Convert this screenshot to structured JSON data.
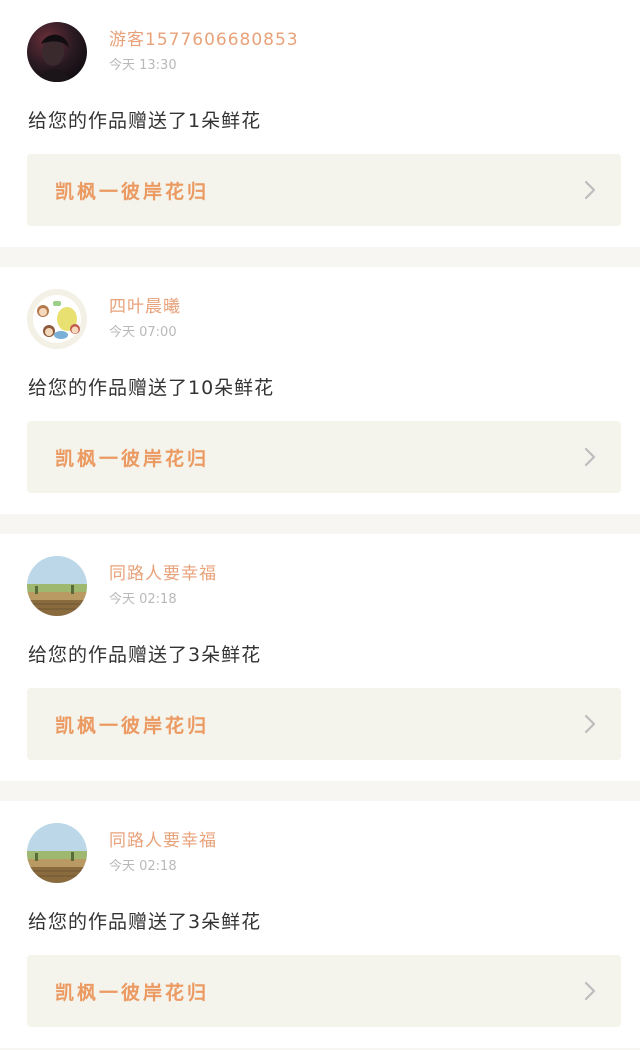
{
  "items": [
    {
      "username": "游客1577606680853",
      "time": "今天 13:30",
      "message": "给您的作品赠送了1朵鲜花",
      "work_title": "凯枫一彼岸花归",
      "avatar_icon": "dark-portrait-avatar"
    },
    {
      "username": "四叶晨曦",
      "time": "今天 07:00",
      "message": "给您的作品赠送了10朵鲜花",
      "work_title": "凯枫一彼岸花归",
      "avatar_icon": "cartoon-characters-avatar"
    },
    {
      "username": "同路人要幸福",
      "time": "今天 02:18",
      "message": "给您的作品赠送了3朵鲜花",
      "work_title": "凯枫一彼岸花归",
      "avatar_icon": "landscape-avatar"
    },
    {
      "username": "同路人要幸福",
      "time": "今天 02:18",
      "message": "给您的作品赠送了3朵鲜花",
      "work_title": "凯枫一彼岸花归",
      "avatar_icon": "landscape-avatar"
    }
  ],
  "colors": {
    "username": "#e8a27a",
    "time": "#b9b9b9",
    "work_title": "#eb9a62",
    "work_link_bg": "#f4f3ec",
    "separator": "#f7f6f3"
  }
}
